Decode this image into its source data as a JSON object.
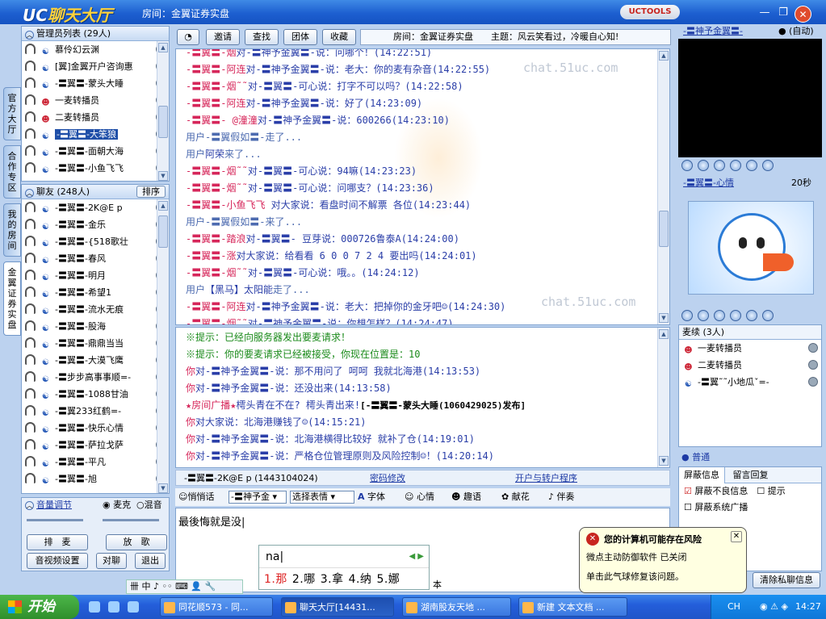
{
  "app": {
    "logo_uc": "UC",
    "logo_name": "聊天大厅",
    "room_title": "房间：金翼证券实盘",
    "uctools": "UCTOOLS"
  },
  "vtabs": [
    "官方大厅",
    "合作专区",
    "我的房间",
    "金翼证券实盘"
  ],
  "admin": {
    "header": "管理员列表 (29人)",
    "items": [
      {
        "name": "慕伶幻云渊",
        "av": "hp"
      },
      {
        "name": "[翼]金翼开户咨询惠",
        "av": "hp"
      },
      {
        "name": "-〓翼〓-蒙头大睡",
        "av": "hp"
      },
      {
        "name": "一麦转播员",
        "av": "face"
      },
      {
        "name": "二麦转播员",
        "av": "face"
      },
      {
        "name": "-〓翼〓-大笨狼",
        "av": "hp",
        "selected": true
      },
      {
        "name": "-〓翼〓-面朝大海",
        "av": "hp"
      },
      {
        "name": "-〓翼〓-小鱼飞飞",
        "av": "hp"
      }
    ]
  },
  "friends": {
    "header": "聊友 (248人)",
    "sort": "排序",
    "items": [
      "-〓翼〓-2K@E p",
      "-〓翼〓-金乐",
      "-〓翼〓-{518歌壮",
      "-〓翼〓-春风",
      "-〓翼〓-明月",
      "-〓翼〓-希望1",
      "-〓翼〓-流水无痕",
      "-〓翼〓-股海",
      "-〓翼〓-鼎鼎当当",
      "-〓翼〓-大漠飞鹰",
      "-〓步步高事事顺=-",
      "-〓翼〓-1088甘油",
      "-〓翼233红鹤=-",
      "-〓翼〓-快乐心情",
      "-〓翼〓-萨拉戈萨",
      "-〓翼〓-平凡",
      "-〓翼〓-旭"
    ]
  },
  "volume": {
    "header": "音量调节",
    "mic": "麦克",
    "mix": "混音",
    "btn_queue": "排　麦",
    "btn_song": "放　歌",
    "btn_av": "音视频设置",
    "btn_talk": "对聊",
    "btn_exit": "退出"
  },
  "toolbar": {
    "invite": "邀请",
    "find": "查找",
    "group": "团体",
    "fav": "收藏",
    "info": "房间：金翼证券实盘　　主题：风云笑看过，冷暖自心知!"
  },
  "chat": [
    {
      "parts": [
        [
          "red",
          "-〓翼〓-烟"
        ],
        [
          "blue",
          "对-〓神予金翼〓-说：问哪个！(14:22:51)"
        ]
      ]
    },
    {
      "parts": [
        [
          "red",
          "-〓翼〓-阿连"
        ],
        [
          "blue",
          "对-〓神予金翼〓-说：老大：你的麦有杂音(14:22:55)"
        ]
      ]
    },
    {
      "parts": [
        [
          "red",
          "-〓翼〓-烟˜˜"
        ],
        [
          "blue",
          "对-〓翼〓-可心说：打字不可以吗？(14:22:58)"
        ]
      ]
    },
    {
      "parts": [
        [
          "red",
          "-〓翼〓-阿连"
        ],
        [
          "blue",
          "对-〓神予金翼〓-说：好了(14:23:09)"
        ]
      ]
    },
    {
      "parts": [
        [
          "red",
          "-〓翼〓- @潼潼"
        ],
        [
          "blue",
          "对-〓神予金翼〓-说：600266(14:23:10)"
        ]
      ]
    },
    {
      "parts": [
        [
          "gray",
          "用户-〓翼假如〓-走了..."
        ]
      ]
    },
    {
      "parts": [
        [
          "gray",
          "用户"
        ],
        [
          "blue",
          "阿荣"
        ],
        [
          "gray",
          "来了..."
        ]
      ]
    },
    {
      "parts": [
        [
          "red",
          "-〓翼〓-烟˜˜"
        ],
        [
          "blue",
          "对-〓翼〓-可心说：94嘛(14:23:23)"
        ]
      ]
    },
    {
      "parts": [
        [
          "red",
          "-〓翼〓-烟˜˜"
        ],
        [
          "blue",
          "对-〓翼〓-可心说：问哪支？(14:23:36)"
        ]
      ]
    },
    {
      "parts": [
        [
          "red",
          "-〓翼〓-小鱼飞飞"
        ],
        [
          "blue",
          " 对大家说：看盘时间不解票 各位(14:23:44)"
        ]
      ]
    },
    {
      "parts": [
        [
          "gray",
          "用户-〓翼假如〓-来了..."
        ]
      ]
    },
    {
      "parts": [
        [
          "red",
          " -〓翼〓-踏浪"
        ],
        [
          "blue",
          "对-〓翼〓- 豆芽说：000726鲁泰A(14:24:00)"
        ]
      ]
    },
    {
      "parts": [
        [
          "red",
          "-〓翼〓-涨"
        ],
        [
          "blue",
          "对大家说：给看看 6 0 0 7 2 4 要出吗(14:24:01)"
        ]
      ]
    },
    {
      "parts": [
        [
          "red",
          "-〓翼〓-烟˜˜"
        ],
        [
          "blue",
          "对-〓翼〓-可心说：哦。。(14:24:12)"
        ]
      ]
    },
    {
      "parts": [
        [
          "gray",
          "用户"
        ],
        [
          "blue",
          "【黑马】太阳能"
        ],
        [
          "gray",
          "走了..."
        ]
      ]
    },
    {
      "parts": [
        [
          "red",
          "-〓翼〓-阿连"
        ],
        [
          "blue",
          "对-〓神予金翼〓-说：老大：把掉你的金牙吧"
        ],
        [
          "blue",
          "☺(14:24:30)"
        ]
      ]
    },
    {
      "parts": [
        [
          "red",
          "-〓翼〓-烟˜˜"
        ],
        [
          "blue",
          "对-〓神予金翼〓-说：你想怎样？(14:24:47)"
        ]
      ]
    }
  ],
  "watermark": "chat.51uc.com",
  "private": [
    {
      "parts": [
        [
          "grn",
          "※提示：已经向服务器发出要麦请求！"
        ]
      ]
    },
    {
      "parts": [
        [
          "grn",
          "※提示：你的要麦请求已经被接受，你现在位置是：10"
        ]
      ]
    },
    {
      "parts": [
        [
          "red",
          "你"
        ],
        [
          "blue",
          "对-〓神予金翼〓-说：那不用问了 呵呵 我就北海港(14:13:53)"
        ]
      ]
    },
    {
      "parts": [
        [
          "red",
          "你"
        ],
        [
          "blue",
          "对-〓神予金翼〓-说：还没出来(14:13:58)"
        ]
      ]
    },
    {
      "parts": [
        [
          "red",
          "★房间广播★"
        ],
        [
          "blue",
          "樗头青在不在? 樗头青出来!"
        ],
        [
          "bold",
          "[-〓翼〓-蒙头大睡(1060429025)发布]"
        ]
      ]
    },
    {
      "parts": [
        [
          "red",
          "你"
        ],
        [
          "blue",
          "对大家说：北海港赚钱了"
        ],
        [
          "blue",
          "☺(14:15:21)"
        ]
      ]
    },
    {
      "parts": [
        [
          "red",
          "你"
        ],
        [
          "blue",
          "对-〓神予金翼〓-说：北海港横得比较好 就补了仓(14:19:01)"
        ]
      ]
    },
    {
      "parts": [
        [
          "red",
          "你"
        ],
        [
          "blue",
          "对-〓神予金翼〓-说：严格仓位管理原则及风险控制☺！(14:20:14)"
        ]
      ]
    }
  ],
  "statusbar": {
    "user": "-〓翼〓-2K@E p (1443104024)",
    "pwd": "密码修改",
    "open": "开户与转户程序"
  },
  "inputbar": {
    "whisper": "悄悄话",
    "target": "-〓神予金",
    "emote": "选择表情",
    "font": "字体",
    "mood": "心情",
    "fun": "趣语",
    "flower": "献花",
    "music": "伴奏"
  },
  "input_text": "最後悔就是没",
  "right": {
    "top_name": "-〓神予金翼〓-",
    "auto": "(自动)",
    "second_name": "-〓翼〓-心情",
    "seconds": "20秒",
    "queue_header": "麦续 (3人)",
    "queue": [
      "一麦转播员",
      "二麦转播员",
      "-〓翼˜˜小地瓜ˇ=-"
    ],
    "normal": "普通",
    "tab_shield": "屏蔽信息",
    "tab_msg": "留言回复",
    "opt1": "屏蔽不良信息",
    "opt_hint": "提示",
    "opt2": "屏蔽系统广播",
    "clear_btn": "清除私聊信息"
  },
  "balloon": {
    "title": "您的计算机可能存在风险",
    "line1": "微点主动防御软件 已关闭",
    "line2": "单击此气球修复该问题。"
  },
  "ime": {
    "typed": "na",
    "cands": [
      "1.那",
      "2.哪",
      "3.拿",
      "4.纳",
      "5.娜"
    ],
    "hidden_char": "本"
  },
  "taskbar": {
    "start": "开始",
    "tasks": [
      "同花顺573 - 同...",
      "聊天大厅[14431...",
      "湖南股友天地 ...",
      "新建 文本文档 ..."
    ],
    "lang": "CH",
    "time": "14:27"
  }
}
